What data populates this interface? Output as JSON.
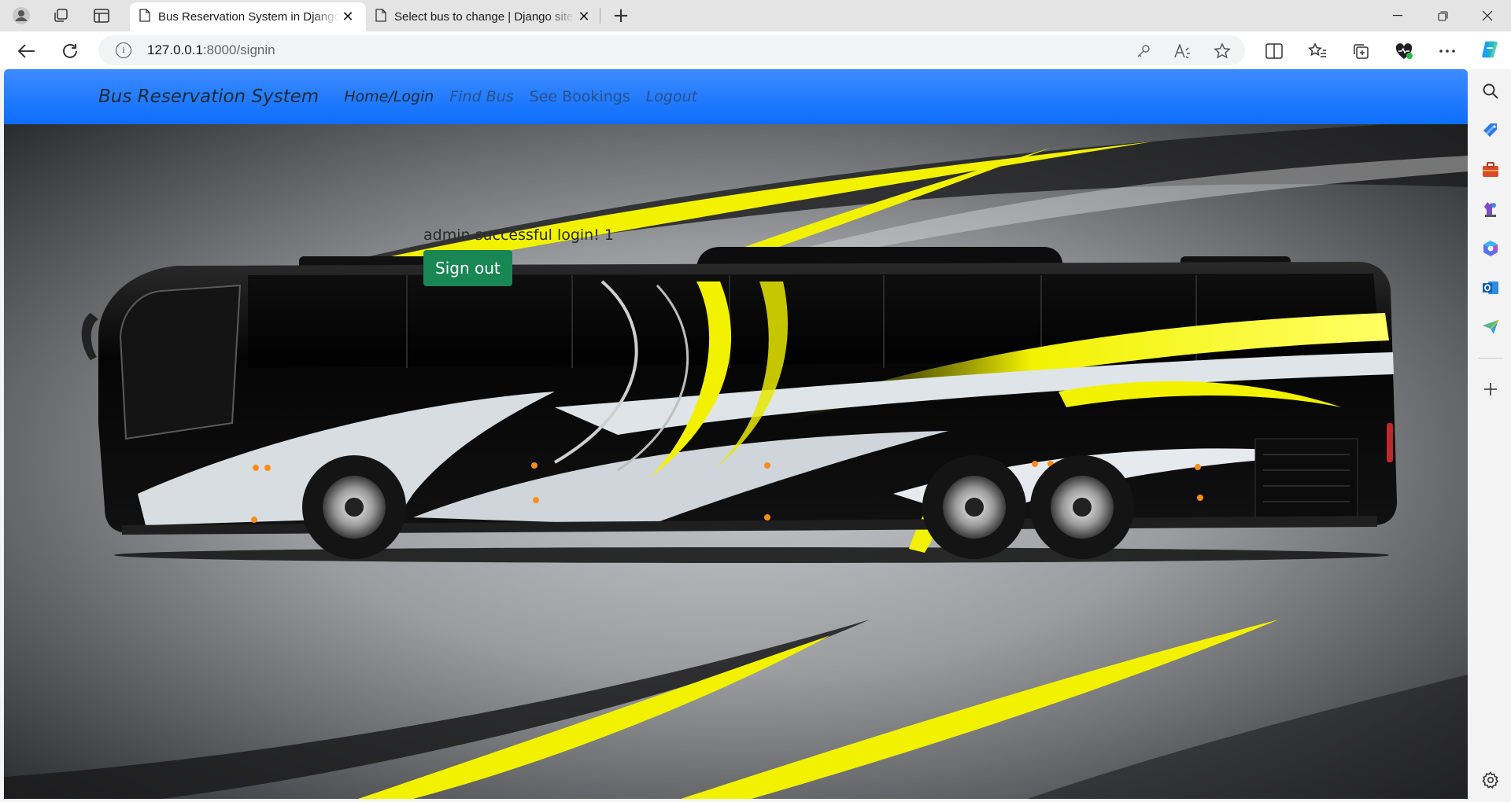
{
  "browser": {
    "tabs": [
      {
        "title": "Bus Reservation System in Django",
        "active": true
      },
      {
        "title": "Select bus to change | Django site admin",
        "active": false
      }
    ],
    "url_host": "127.0.0.1",
    "url_path": ":8000/signin"
  },
  "navbar": {
    "brand": "Bus Reservation System",
    "links": [
      "Home/Login",
      "Find Bus",
      "See Bookings",
      "Logout"
    ]
  },
  "main": {
    "message": "admin successful login! 1",
    "signout_label": "Sign out"
  },
  "colors": {
    "navbar": "#0d6efd",
    "signout_button": "#198754",
    "bus_accent": "#f2f200",
    "bus_body": "#0b0b0b"
  }
}
